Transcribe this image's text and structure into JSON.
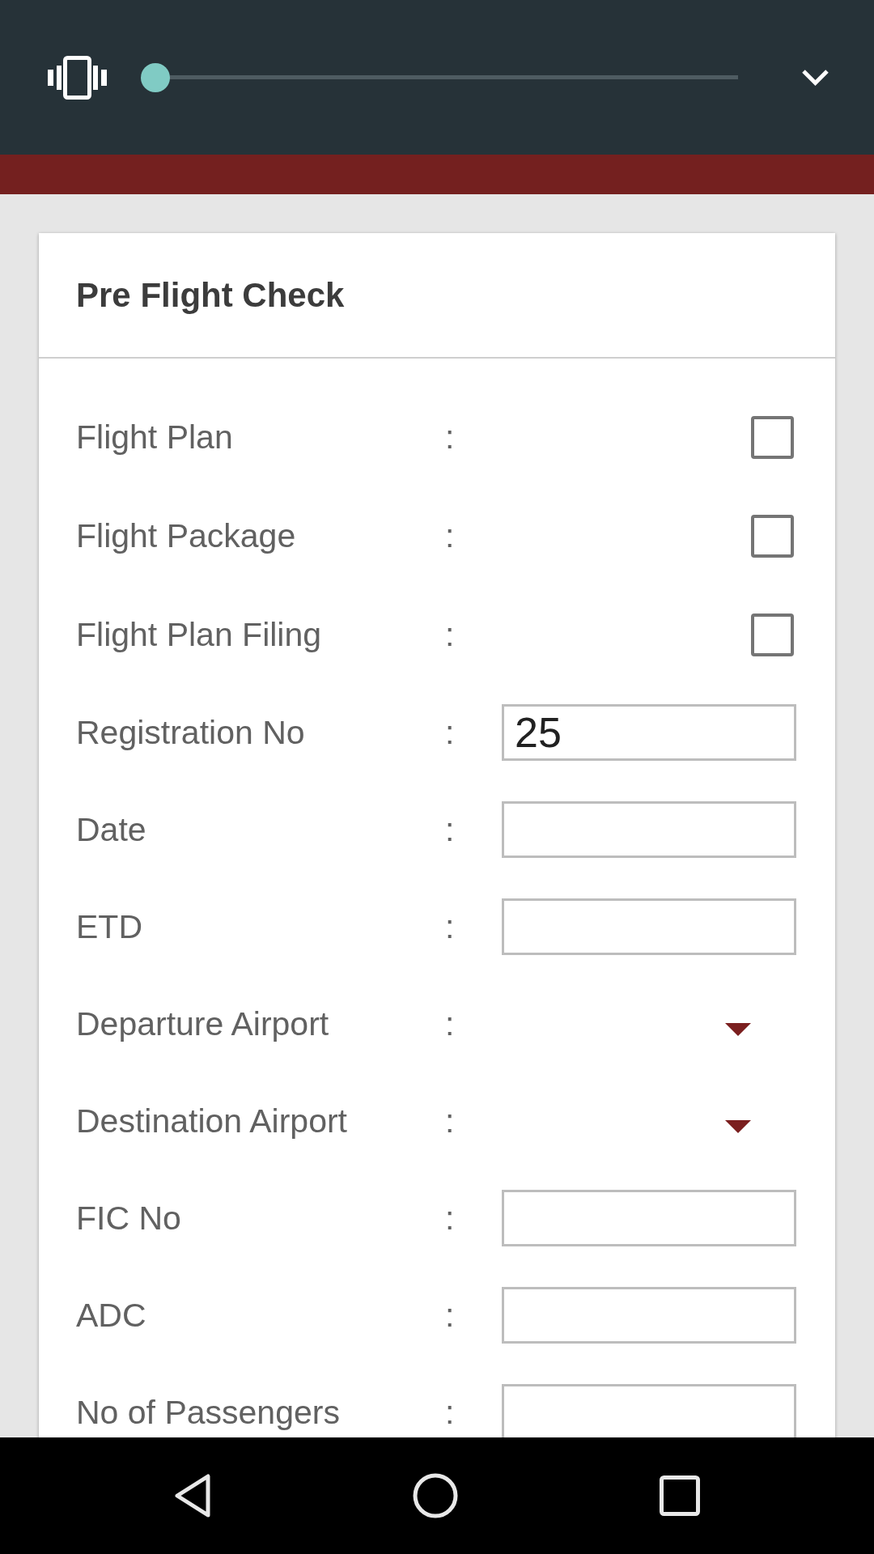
{
  "volume_panel": {
    "slider": {
      "level": 0
    }
  },
  "form": {
    "title": "Pre Flight Check",
    "fields": [
      {
        "kind": "checkbox",
        "label": "Flight Plan",
        "separator": ":",
        "checked": false
      },
      {
        "kind": "checkbox",
        "label": "Flight Package",
        "separator": ":",
        "checked": false
      },
      {
        "kind": "checkbox",
        "label": "Flight Plan Filing",
        "separator": ":",
        "checked": false
      },
      {
        "kind": "text",
        "label": "Registration No",
        "separator": ":",
        "value": "25"
      },
      {
        "kind": "text",
        "label": "Date",
        "separator": ":"
      },
      {
        "kind": "text",
        "label": "ETD",
        "separator": ":"
      },
      {
        "kind": "dropdown",
        "label": "Departure Airport",
        "separator": ":"
      },
      {
        "kind": "dropdown",
        "label": "Destination Airport",
        "separator": ":"
      },
      {
        "kind": "text",
        "label": "FIC No",
        "separator": ":"
      },
      {
        "kind": "text",
        "label": "ADC",
        "separator": ":"
      },
      {
        "kind": "text",
        "label": "No of Passengers",
        "separator": ":"
      }
    ]
  }
}
